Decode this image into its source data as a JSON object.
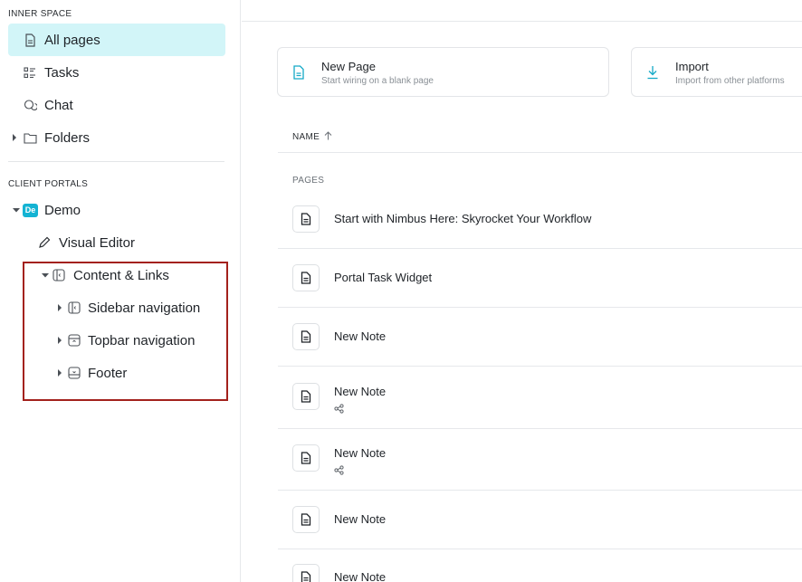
{
  "sidebar": {
    "inner_space_label": "INNER SPACE",
    "items": [
      {
        "label": "All pages",
        "icon": "document-icon"
      },
      {
        "label": "Tasks",
        "icon": "task-list-icon"
      },
      {
        "label": "Chat",
        "icon": "chat-icon"
      },
      {
        "label": "Folders",
        "icon": "folder-icon"
      }
    ],
    "client_portals_label": "CLIENT PORTALS",
    "portal": {
      "badge": "De",
      "name": "Demo",
      "visual_editor": "Visual Editor",
      "content_links": "Content & Links",
      "children": [
        {
          "label": "Sidebar navigation",
          "icon": "sidebar-layout-icon"
        },
        {
          "label": "Topbar navigation",
          "icon": "topbar-layout-icon"
        },
        {
          "label": "Footer",
          "icon": "footer-layout-icon"
        }
      ]
    }
  },
  "main": {
    "cards": [
      {
        "title": "New Page",
        "subtitle": "Start wiring on a blank page",
        "icon": "document-icon"
      },
      {
        "title": "Import",
        "subtitle": "Import from other platforms",
        "icon": "download-icon"
      }
    ],
    "column_header": "NAME",
    "group_label": "PAGES",
    "rows": [
      {
        "title": "Start with Nimbus Here: Skyrocket Your Workflow",
        "shared": false
      },
      {
        "title": "Portal Task Widget",
        "shared": false
      },
      {
        "title": "New Note",
        "shared": false
      },
      {
        "title": "New Note",
        "shared": true
      },
      {
        "title": "New Note",
        "shared": true
      },
      {
        "title": "New Note",
        "shared": false
      },
      {
        "title": "New Note",
        "shared": false
      }
    ]
  },
  "colors": {
    "active_bg": "#d2f5f8",
    "accent": "#14b3d3",
    "highlight_border": "#a3211c"
  }
}
